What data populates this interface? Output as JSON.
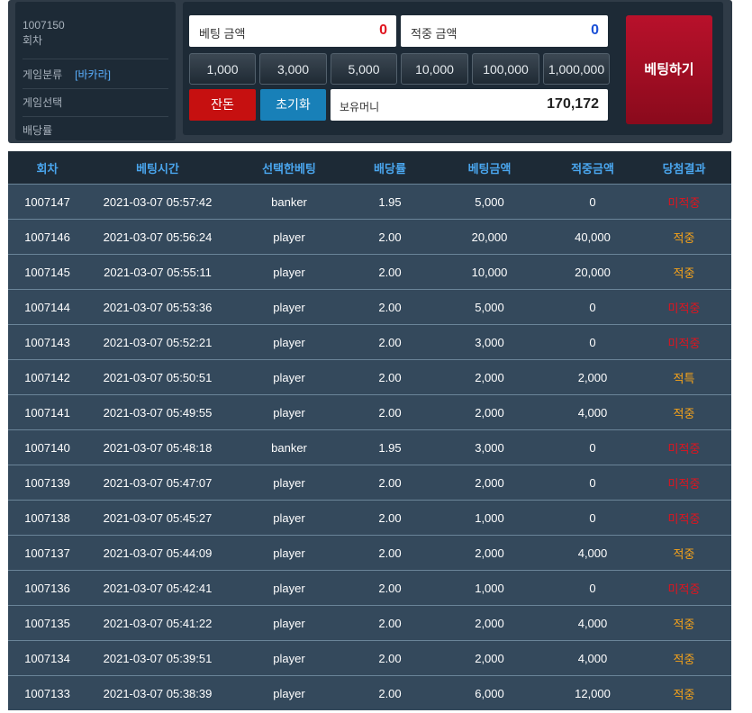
{
  "info": {
    "round_number": "1007150",
    "round_label": "회차",
    "game_type_label": "게임분류",
    "game_type_value": "[바카라]",
    "game_select_label": "게임선택",
    "odds_label": "배당률"
  },
  "bet_panel": {
    "bet_amount_label": "베팅 금액",
    "bet_amount_value": "0",
    "win_amount_label": "적중 금액",
    "win_amount_value": "0",
    "chips": [
      "1,000",
      "3,000",
      "5,000",
      "10,000",
      "100,000",
      "1,000,000"
    ],
    "reset_label": "잔돈",
    "init_label": "초기화",
    "money_label": "보유머니",
    "money_value": "170,172",
    "bet_button_label": "베팅하기"
  },
  "colors": {
    "bet_amount_value": "#e0141e",
    "win_amount_value": "#1a4fd6",
    "win_result": "#f5a21a",
    "lose_result": "#e0141e"
  },
  "table": {
    "headers": [
      "회차",
      "베팅시간",
      "선택한베팅",
      "배당률",
      "베팅금액",
      "적중금액",
      "당첨결과"
    ],
    "rows": [
      {
        "round": "1007147",
        "time": "2021-03-07 05:57:42",
        "pick": "banker",
        "odds": "1.95",
        "bet": "5,000",
        "win": "0",
        "result": "미적중",
        "won": false
      },
      {
        "round": "1007146",
        "time": "2021-03-07 05:56:24",
        "pick": "player",
        "odds": "2.00",
        "bet": "20,000",
        "win": "40,000",
        "result": "적중",
        "won": true
      },
      {
        "round": "1007145",
        "time": "2021-03-07 05:55:11",
        "pick": "player",
        "odds": "2.00",
        "bet": "10,000",
        "win": "20,000",
        "result": "적중",
        "won": true
      },
      {
        "round": "1007144",
        "time": "2021-03-07 05:53:36",
        "pick": "player",
        "odds": "2.00",
        "bet": "5,000",
        "win": "0",
        "result": "미적중",
        "won": false
      },
      {
        "round": "1007143",
        "time": "2021-03-07 05:52:21",
        "pick": "player",
        "odds": "2.00",
        "bet": "3,000",
        "win": "0",
        "result": "미적중",
        "won": false
      },
      {
        "round": "1007142",
        "time": "2021-03-07 05:50:51",
        "pick": "player",
        "odds": "2.00",
        "bet": "2,000",
        "win": "2,000",
        "result": "적특",
        "won": true
      },
      {
        "round": "1007141",
        "time": "2021-03-07 05:49:55",
        "pick": "player",
        "odds": "2.00",
        "bet": "2,000",
        "win": "4,000",
        "result": "적중",
        "won": true
      },
      {
        "round": "1007140",
        "time": "2021-03-07 05:48:18",
        "pick": "banker",
        "odds": "1.95",
        "bet": "3,000",
        "win": "0",
        "result": "미적중",
        "won": false
      },
      {
        "round": "1007139",
        "time": "2021-03-07 05:47:07",
        "pick": "player",
        "odds": "2.00",
        "bet": "2,000",
        "win": "0",
        "result": "미적중",
        "won": false
      },
      {
        "round": "1007138",
        "time": "2021-03-07 05:45:27",
        "pick": "player",
        "odds": "2.00",
        "bet": "1,000",
        "win": "0",
        "result": "미적중",
        "won": false
      },
      {
        "round": "1007137",
        "time": "2021-03-07 05:44:09",
        "pick": "player",
        "odds": "2.00",
        "bet": "2,000",
        "win": "4,000",
        "result": "적중",
        "won": true
      },
      {
        "round": "1007136",
        "time": "2021-03-07 05:42:41",
        "pick": "player",
        "odds": "2.00",
        "bet": "1,000",
        "win": "0",
        "result": "미적중",
        "won": false
      },
      {
        "round": "1007135",
        "time": "2021-03-07 05:41:22",
        "pick": "player",
        "odds": "2.00",
        "bet": "2,000",
        "win": "4,000",
        "result": "적중",
        "won": true
      },
      {
        "round": "1007134",
        "time": "2021-03-07 05:39:51",
        "pick": "player",
        "odds": "2.00",
        "bet": "2,000",
        "win": "4,000",
        "result": "적중",
        "won": true
      },
      {
        "round": "1007133",
        "time": "2021-03-07 05:38:39",
        "pick": "player",
        "odds": "2.00",
        "bet": "6,000",
        "win": "12,000",
        "result": "적중",
        "won": true
      }
    ]
  }
}
